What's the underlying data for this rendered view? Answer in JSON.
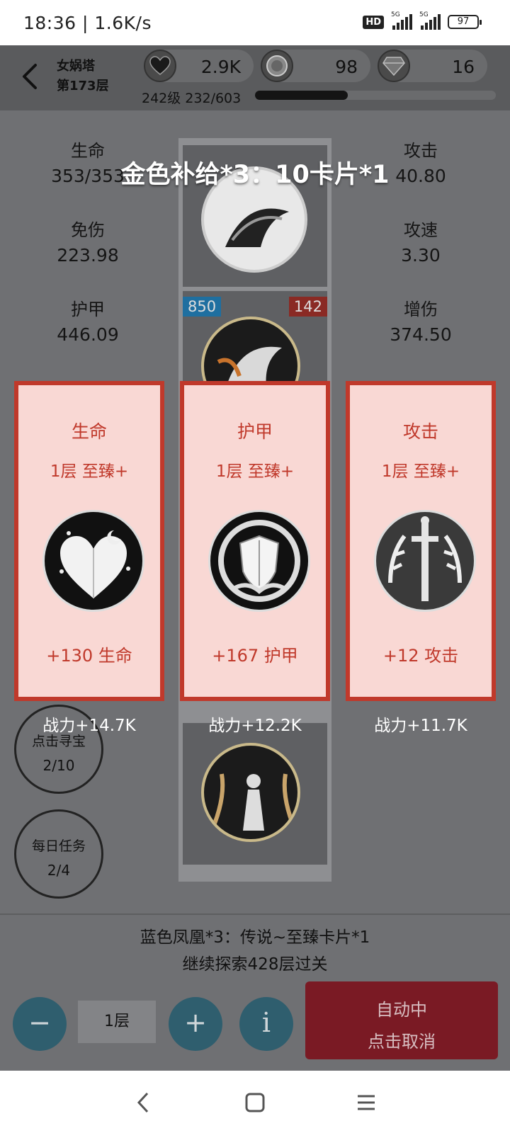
{
  "status_bar": {
    "time": "18:36",
    "speed": "1.6K/s",
    "hd": "HD",
    "net1": "5G",
    "net2": "5G",
    "battery": "97"
  },
  "header": {
    "tower": "女娲塔",
    "floor": "第173层",
    "resources": [
      {
        "icon": "heart-coin-icon",
        "value": "2.9K"
      },
      {
        "icon": "silver-coin-icon",
        "value": "98"
      },
      {
        "icon": "diamond-coin-icon",
        "value": "16"
      }
    ],
    "level_text": "242级 232/603",
    "xp_fraction": 0.385
  },
  "stats": {
    "left": [
      {
        "label": "生命",
        "value": "353/353"
      },
      {
        "label": "免伤",
        "value": "223.98"
      },
      {
        "label": "护甲",
        "value": "446.09"
      }
    ],
    "right": [
      {
        "label": "攻击",
        "value": "40.80"
      },
      {
        "label": "攻速",
        "value": "3.30"
      },
      {
        "label": "增伤",
        "value": "374.50"
      }
    ]
  },
  "reward_title": "金色补给*3：10卡片*1",
  "card_tags": {
    "left": "850",
    "right": "142"
  },
  "options": [
    {
      "title": "生命",
      "sub": "1层 至臻+",
      "icon": "heart-medal-icon",
      "bonus": "+130 生命",
      "power": "战力+14.7K"
    },
    {
      "title": "护甲",
      "sub": "1层 至臻+",
      "icon": "shield-medal-icon",
      "bonus": "+167 护甲",
      "power": "战力+12.2K"
    },
    {
      "title": "攻击",
      "sub": "1层 至臻+",
      "icon": "sword-medal-icon",
      "bonus": "+12 攻击",
      "power": "战力+11.7K"
    }
  ],
  "side": {
    "treasure": {
      "label": "点击寻宝",
      "count": "2/10"
    },
    "daily": {
      "label": "每日任务",
      "count": "2/4"
    }
  },
  "bottom": {
    "line1": "蓝色凤凰*3：传说~至臻卡片*1",
    "line2": "继续探索428层过关",
    "minus": "−",
    "floor": "1层",
    "plus": "+",
    "info": "i",
    "auto_line1": "自动中",
    "auto_line2": "点击取消"
  },
  "colors": {
    "card_border": "#c0392b",
    "card_bg": "#f9d8d4",
    "round_button": "#2f5e6e",
    "auto_button": "#7a1a24"
  }
}
